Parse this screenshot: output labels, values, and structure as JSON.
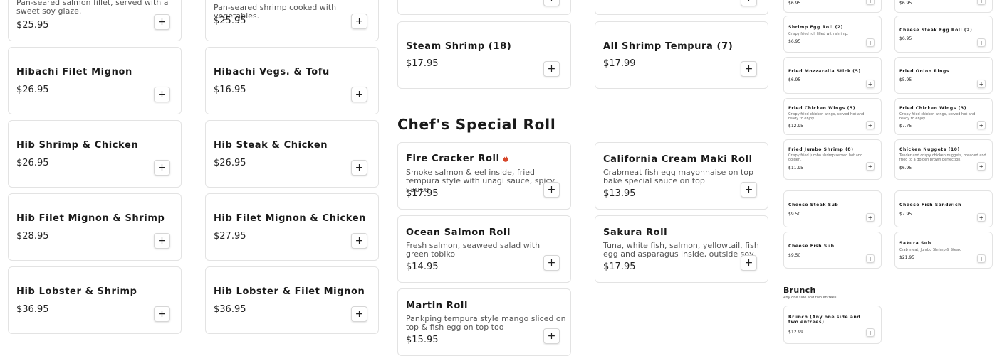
{
  "col1": [
    {
      "name": "",
      "desc": "Pan-seared salmon fillet, served with a sweet soy glaze.",
      "price": "$25.95"
    },
    {
      "name": "Hibachi Filet Mignon",
      "desc": "",
      "price": "$26.95"
    },
    {
      "name": "Hib Shrimp & Chicken",
      "desc": "",
      "price": "$26.95"
    },
    {
      "name": "Hib Filet Mignon & Shrimp",
      "desc": "",
      "price": "$28.95"
    },
    {
      "name": "Hib Lobster & Shrimp",
      "desc": "",
      "price": "$36.95"
    }
  ],
  "col2": [
    {
      "name": "",
      "desc": "Pan-seared shrimp cooked with vegetables.",
      "price": "$25.95"
    },
    {
      "name": "Hibachi Vegs. & Tofu",
      "desc": "",
      "price": "$16.95"
    },
    {
      "name": "Hib Steak & Chicken",
      "desc": "",
      "price": "$26.95"
    },
    {
      "name": "Hib Filet Mignon & Chicken",
      "desc": "",
      "price": "$27.95"
    },
    {
      "name": "Hib Lobster & Filet Mignon",
      "desc": "",
      "price": "$36.95"
    }
  ],
  "col3": [
    {
      "name": "Steam Shrimp (18)",
      "desc": "",
      "price": "$17.95"
    },
    {
      "name": "Fire Cracker Roll",
      "desc": "Smoke salmon & eel inside, fried tempura style with unagi sauce, spicy sauce",
      "price": "$17.95",
      "spicy": true
    },
    {
      "name": "Ocean Salmon Roll",
      "desc": "Fresh salmon, seaweed salad with green tobiko",
      "price": "$14.95"
    },
    {
      "name": "Martin Roll",
      "desc": "Pankping tempura style mango sliced on top & fish egg on top too",
      "price": "$15.95"
    }
  ],
  "col4": [
    {
      "name": "All Shrimp Tempura (7)",
      "desc": "",
      "price": "$17.99"
    },
    {
      "name": "California Cream Maki Roll",
      "desc": "Crabmeat fish egg mayonnaise on top bake special sauce on top",
      "price": "$13.95"
    },
    {
      "name": "Sakura Roll",
      "desc": "Tuna, white fish, salmon, yellowtail, fish egg and asparagus inside, outside soy pepper...",
      "price": "$17.95"
    }
  ],
  "section_chefs": "Chef's Special Roll",
  "small_left": [
    {
      "name": "",
      "desc": "",
      "price": "$6.95"
    },
    {
      "name": "Shrimp Egg Roll (2)",
      "desc": "Crispy fried roll filled with shrimp.",
      "price": "$6.95"
    },
    {
      "name": "Fried Mozzarella Stick (5)",
      "desc": "",
      "price": "$6.95"
    },
    {
      "name": "Fried Chicken Wings (5)",
      "desc": "Crispy fried chicken wings, served hot and ready to enjoy.",
      "price": "$12.95"
    },
    {
      "name": "Fried Jumbo Shrimp (8)",
      "desc": "Crispy fried jumbo shrimp served hot and golden.",
      "price": "$11.95"
    },
    {
      "name": "Cheese Steak Sub",
      "desc": "",
      "price": "$9.50"
    },
    {
      "name": "Cheese Fish Sub",
      "desc": "",
      "price": "$9.50"
    }
  ],
  "small_right": [
    {
      "name": "",
      "desc": "",
      "price": "$6.95"
    },
    {
      "name": "Cheese Steak Egg Roll (2)",
      "desc": "",
      "price": "$6.95"
    },
    {
      "name": "Fried Onion Rings",
      "desc": "",
      "price": "$5.95"
    },
    {
      "name": "Fried Chicken Wings (3)",
      "desc": "Crispy fried chicken wings, served hot and ready to enjoy.",
      "price": "$7.75"
    },
    {
      "name": "Chicken Nuggets (10)",
      "desc": "Tender and crispy chicken nuggets, breaded and fried to a golden brown perfection.",
      "price": "$6.95"
    },
    {
      "name": "Cheese Fish Sandwich",
      "desc": "",
      "price": "$7.95"
    },
    {
      "name": "Sakura Sub",
      "desc": "Crab meat, Jumbo Shrimp & Steak",
      "price": "$21.95"
    }
  ],
  "brunch": {
    "title": "Brunch",
    "subtitle": "Any one side and two entrees",
    "item": {
      "name": "Brunch (Any one side and two entrees)",
      "desc": "",
      "price": "$12.99"
    }
  },
  "add_symbol": "+",
  "icons": {
    "add": "plus-icon",
    "spicy": "chili-flame-icon"
  },
  "colors": {
    "border": "#e3e3e3",
    "text": "#1a1a1a",
    "spicy": "#d7462a"
  }
}
